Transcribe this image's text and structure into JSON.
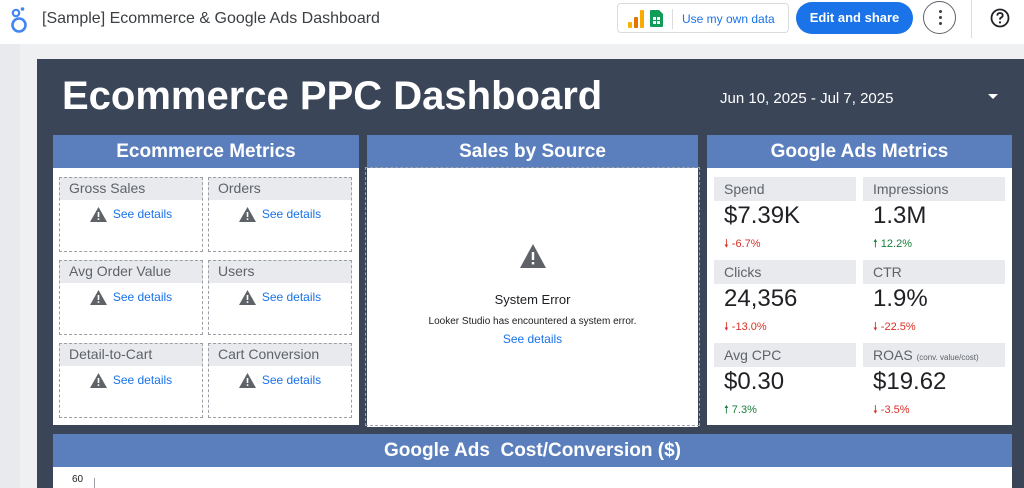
{
  "app": {
    "title": "[Sample] Ecommerce & Google Ads Dashboard",
    "logo_icon": "looker-studio-logo-icon",
    "data_chip_label": "Use my own data",
    "edit_share_label": "Edit and share",
    "more_icon": "more-vert-icon",
    "help_icon": "help-icon",
    "accent": "#1a73e8"
  },
  "report": {
    "title": "Ecommerce PPC Dashboard",
    "date_range": "Jun 10, 2025 - Jul 7, 2025",
    "background": "#3b4558",
    "header_color": "#5b7fbd"
  },
  "ecommerce": {
    "title": "Ecommerce Metrics",
    "tiles": [
      {
        "label": "Gross Sales",
        "link": "See details"
      },
      {
        "label": "Orders",
        "link": "See details"
      },
      {
        "label": "Avg Order Value",
        "link": "See details"
      },
      {
        "label": "Users",
        "link": "See details"
      },
      {
        "label": "Detail-to-Cart",
        "link": "See details"
      },
      {
        "label": "Cart Conversion",
        "link": "See details"
      }
    ]
  },
  "sales": {
    "title": "Sales by Source",
    "error_title": "System Error",
    "error_message": "Looker Studio has encountered a system error.",
    "error_link": "See details"
  },
  "ads": {
    "title": "Google Ads Metrics",
    "cards": [
      {
        "label": "Spend",
        "value": "$7.39K",
        "delta": "-6.7%",
        "direction": "down"
      },
      {
        "label": "Impressions",
        "value": "1.3M",
        "delta": "12.2%",
        "direction": "up"
      },
      {
        "label": "Clicks",
        "value": "24,356",
        "delta": "-13.0%",
        "direction": "down"
      },
      {
        "label": "CTR",
        "value": "1.9%",
        "delta": "-22.5%",
        "direction": "down"
      },
      {
        "label": "Avg CPC",
        "value": "$0.30",
        "delta": "7.3%",
        "direction": "up"
      },
      {
        "label": "ROAS",
        "note": "(conv. value/cost)",
        "value": "$19.62",
        "delta": "-3.5%",
        "direction": "down"
      }
    ]
  },
  "cost_chart": {
    "title": "Google Ads  Cost/Conversion ($)",
    "y_tick_top": "60"
  },
  "status_colors": {
    "up": "#188038",
    "down": "#d93025"
  }
}
